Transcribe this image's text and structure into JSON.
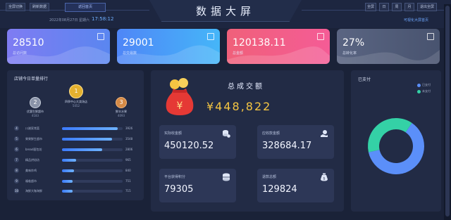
{
  "header": {
    "title": "数据大屏",
    "left_buttons": [
      "全屏切换",
      "刷新数据"
    ],
    "back_button": "返回首页",
    "date_text": "2022年08月27日 星期六",
    "time_text": "17:58:12",
    "right_link": "可视化大屏首页",
    "tabs": [
      "全屏",
      "日",
      "周",
      "月",
      "退出全屏"
    ]
  },
  "stats_cards": [
    {
      "value": "28510",
      "label": "总访问数",
      "icon": "calendar-icon",
      "colors": [
        "#7f7cf2",
        "#5a86f0"
      ]
    },
    {
      "value": "29001",
      "label": "总交易数",
      "icon": "image-icon",
      "colors": [
        "#4f86f7",
        "#45b6f8"
      ]
    },
    {
      "value": "120138.11",
      "label": "总金额",
      "icon": "card-icon",
      "colors": [
        "#f0607a",
        "#f45c96"
      ]
    },
    {
      "value": "27%",
      "label": "总转化率",
      "icon": "chart-icon",
      "colors": [
        "#5a6582",
        "#48536f"
      ]
    }
  ],
  "ranking": {
    "title": "店铺今日单量排行",
    "podium": [
      {
        "rank": "2",
        "name": "优惠生鲜超市",
        "value": "4183",
        "color": "#8a93a8"
      },
      {
        "rank": "1",
        "name": "四季中心大卖场店",
        "value": "5052",
        "color": "#e5b12f"
      },
      {
        "rank": "3",
        "name": "鲜丰水果",
        "value": "4093",
        "color": "#d58a46"
      }
    ],
    "rows": [
      {
        "rank": "4",
        "name": "川湘家常菜",
        "value": "3926",
        "ratio": 0.92
      },
      {
        "rank": "5",
        "name": "果果鲜生超市",
        "value": "3548",
        "ratio": 0.83
      },
      {
        "rank": "6",
        "name": "bread面包坊",
        "value": "2806",
        "ratio": 0.66
      },
      {
        "rank": "7",
        "name": "精品烘焙坊",
        "value": "965",
        "ratio": 0.23
      },
      {
        "rank": "8",
        "name": "美味炸鸡",
        "value": "840",
        "ratio": 0.2
      },
      {
        "rank": "9",
        "name": "福临超市",
        "value": "751",
        "ratio": 0.18
      },
      {
        "rank": "10",
        "name": "海鲜大咖海鲜",
        "value": "715",
        "ratio": 0.17
      }
    ]
  },
  "total": {
    "label": "总成交额",
    "value": "¥448,822",
    "items": [
      {
        "label": "实际收金额",
        "value": "450120.52",
        "icon": "coins-icon"
      },
      {
        "label": "应收款金额",
        "value": "328684.17",
        "icon": "hand-money-icon"
      },
      {
        "label": "平台获得积分",
        "value": "79305",
        "icon": "database-icon"
      },
      {
        "label": "退款总额",
        "value": "129824",
        "icon": "money-bag-icon"
      }
    ]
  },
  "pie": {
    "title": "已支付",
    "legend": [
      {
        "name": "已支付",
        "color": "#5b8ff9"
      },
      {
        "name": "未支付",
        "color": "#34d1a6"
      }
    ],
    "chart_data": {
      "type": "pie",
      "categories": [
        "已支付",
        "未支付"
      ],
      "values": [
        62,
        38
      ]
    }
  }
}
